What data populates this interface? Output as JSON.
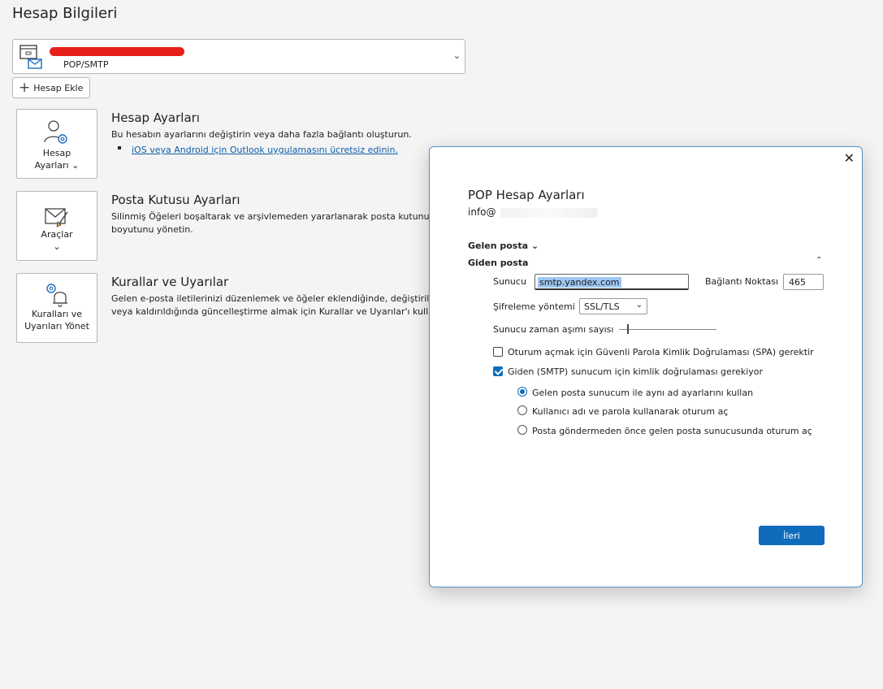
{
  "page": {
    "title": "Hesap Bilgileri"
  },
  "account": {
    "type": "POP/SMTP",
    "chevron": "⌄"
  },
  "add_account": {
    "label": "Hesap Ekle"
  },
  "sections": [
    {
      "tile_line1": "Hesap",
      "tile_line2": "Ayarları ⌄",
      "title": "Hesap Ayarları",
      "desc": "Bu hesabın ayarlarını değiştirin veya daha fazla bağlantı oluşturun.",
      "link": "iOS veya Android için Outlook uygulamasını ücretsiz edinin."
    },
    {
      "tile_line1": "Araçlar",
      "tile_line2": "⌄",
      "title": "Posta Kutusu Ayarları",
      "desc_line1": "Silinmiş Öğeleri boşaltarak ve arşivlemeden yararlanarak posta kutunuzun",
      "desc_line2": "boyutunu yönetin."
    },
    {
      "tile_line1": "Kuralları ve",
      "tile_line2": "Uyarıları Yönet",
      "title": "Kurallar ve Uyarılar",
      "desc_line1": "Gelen e-posta iletilerinizi düzenlemek ve öğeler eklendiğinde, değiştirildiğinde",
      "desc_line2": "veya kaldırıldığında güncelleştirme almak için Kurallar ve Uyarılar'ı kullanın."
    }
  ],
  "dialog": {
    "close": "✕",
    "title": "POP Hesap Ayarları",
    "email_prefix": "info@",
    "incoming_label": "Gelen posta ⌄",
    "outgoing_label": "Giden posta",
    "outgoing_chevron": "⌃",
    "server_label": "Sunucu",
    "server_value": "smtp.yandex.com",
    "port_label": "Bağlantı Noktası",
    "port_value": "465",
    "encryption_label": "Şifreleme yöntemi",
    "encryption_value": "SSL/TLS",
    "timeout_label": "Sunucu zaman aşımı sayısı",
    "spa_label": "Oturum açmak için Güvenli Parola Kimlik Doğrulaması (SPA) gerektir",
    "smtp_auth_label": "Giden (SMTP) sunucum için kimlik doğrulaması gerekiyor",
    "radio1": "Gelen posta sunucum ile aynı ad ayarlarını kullan",
    "radio2": "Kullanıcı adı ve parola kullanarak oturum aç",
    "radio3": "Posta göndermeden önce gelen posta sunucusunda oturum aç",
    "next_label": "İleri"
  },
  "colors": {
    "accent": "#0f6cbd",
    "redact": "#e8201a",
    "link": "#0f5ea8"
  }
}
